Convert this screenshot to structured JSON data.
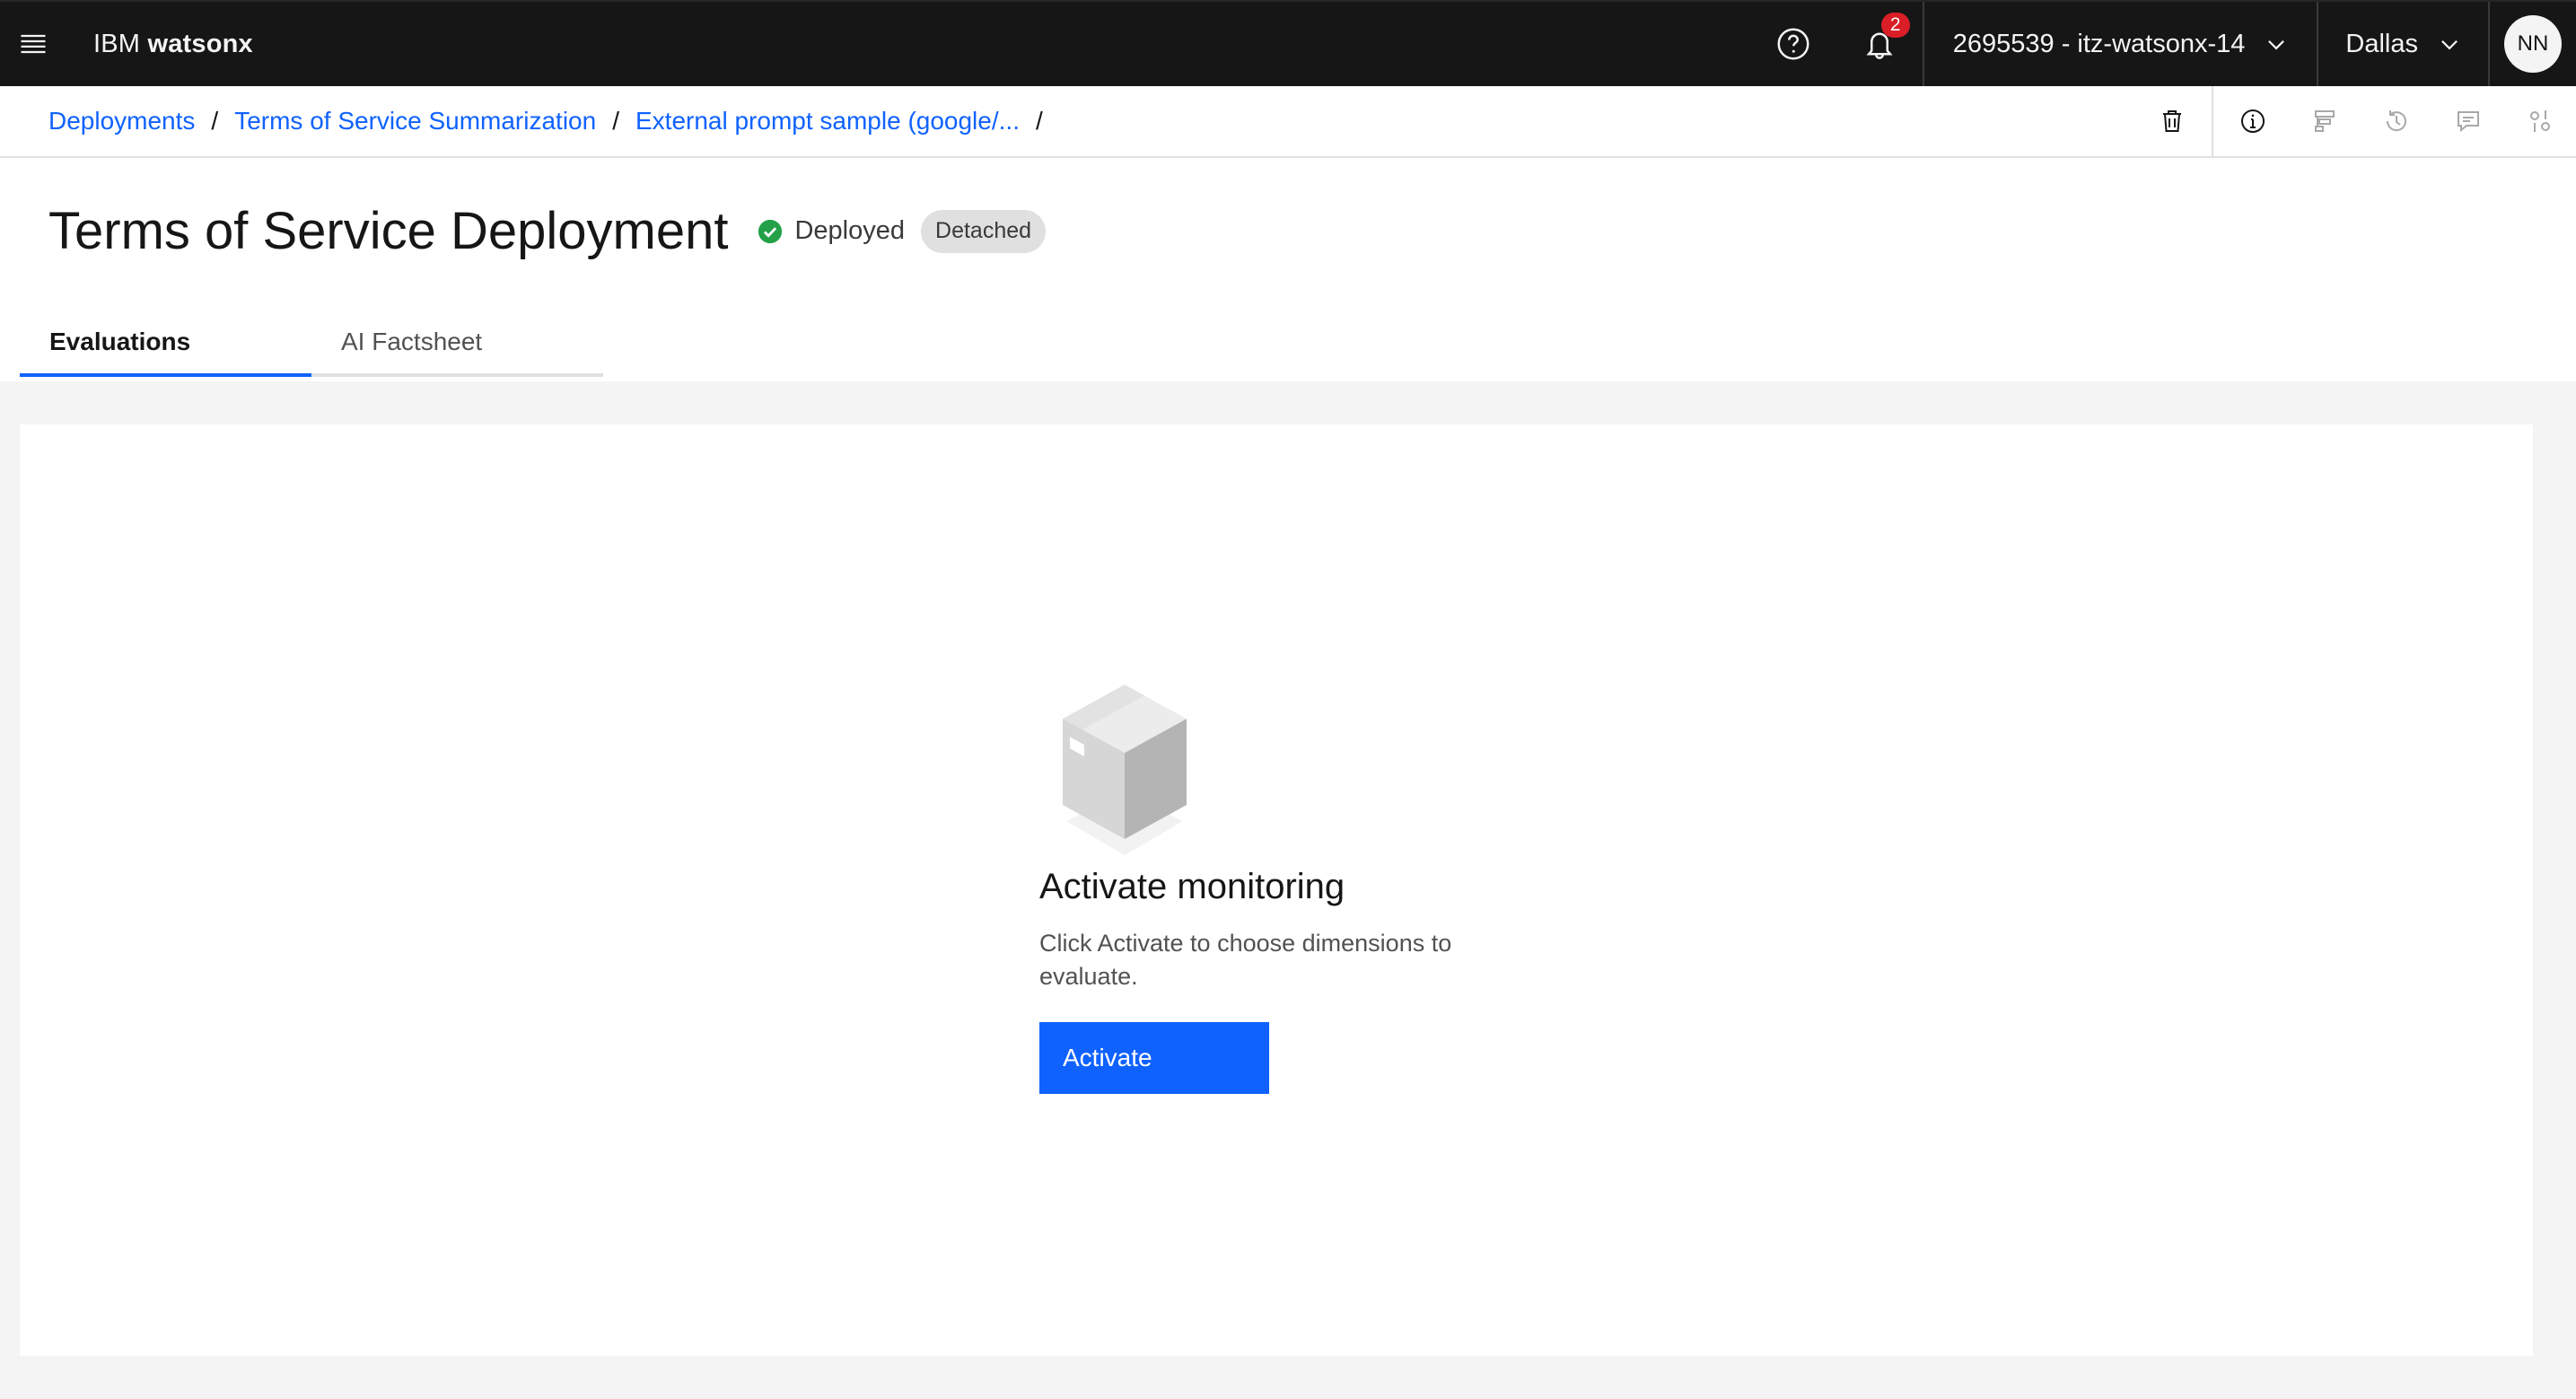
{
  "header": {
    "brand_prefix": "IBM",
    "brand_product": "watsonx",
    "notification_count": "2",
    "account": "2695539 - itz-watsonx-14",
    "region": "Dallas",
    "avatar_initials": "NN",
    "icons": [
      "menu-icon",
      "help-icon",
      "notification-icon",
      "chevron-down-icon"
    ]
  },
  "breadcrumb": {
    "items": [
      "Deployments",
      "Terms of Service Summarization",
      "External prompt sample (google/..."
    ],
    "separator": "/"
  },
  "toolbar": {
    "icons": [
      "trash-icon",
      "information-icon",
      "lineage-icon",
      "history-icon",
      "comment-icon",
      "settings-adjust-icon"
    ]
  },
  "page": {
    "title": "Terms of Service Deployment",
    "status": "Deployed",
    "status_color": "#24a148",
    "tag": "Detached"
  },
  "tabs": [
    {
      "label": "Evaluations",
      "active": true
    },
    {
      "label": "AI Factsheet",
      "active": false
    }
  ],
  "empty_state": {
    "illustration": "box-illustration",
    "title": "Activate monitoring",
    "description": "Click Activate to choose dimensions to evaluate.",
    "button_label": "Activate"
  },
  "colors": {
    "accent": "#0f62fe",
    "header_bg": "#161616",
    "badge": "#da1e28"
  }
}
